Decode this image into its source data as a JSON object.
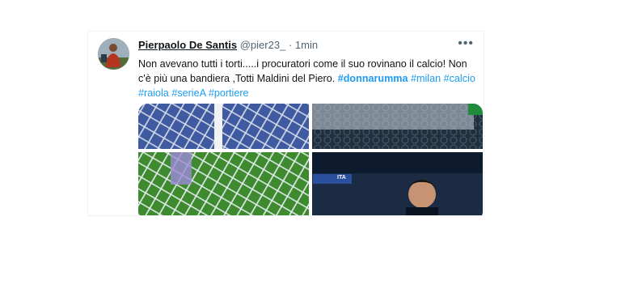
{
  "tweet": {
    "display_name": "Pierpaolo De Santis",
    "handle": "@pier23_",
    "separator": "·",
    "time": "1min",
    "more_label": "•••",
    "text_line1": "Non avevano tutti i torti.....i procuratori come il suo rovinano il calcio! Non",
    "text_line2": "c'è più una bandiera ,Totti Maldini del Piero.",
    "hashtags_line2": [
      "#donnarumma",
      "#milan",
      "#calcio"
    ],
    "hashtags_line3": [
      "#raiola",
      "#serieA",
      "#portiere"
    ]
  },
  "media": {
    "score_badge": "ITA"
  },
  "colors": {
    "accent": "#1d9bf0",
    "text": "#0f1419",
    "secondary": "#536471"
  }
}
